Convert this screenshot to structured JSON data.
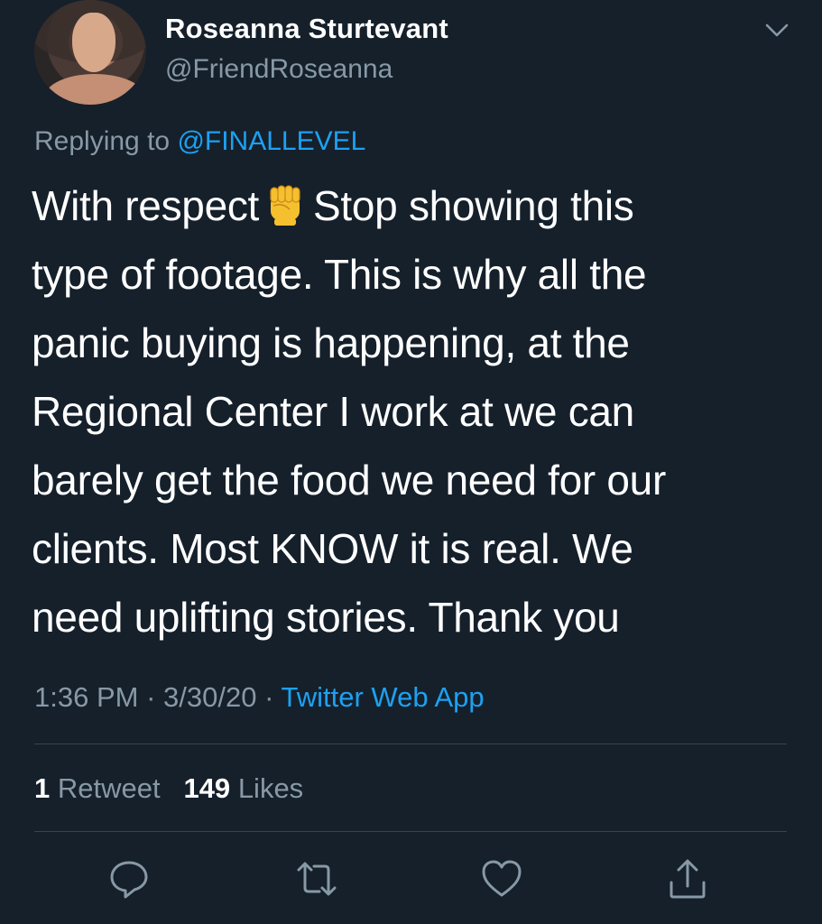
{
  "author": {
    "name": "Roseanna Sturtevant",
    "handle": "@FriendRoseanna",
    "avatar_icon": "profile-photo"
  },
  "reply": {
    "prefix": "Replying to",
    "mention": "@FINALLEVEL"
  },
  "tweet": {
    "text_before_emoji": "With respect",
    "emoji": "raised-fist-emoji",
    "text_after_emoji": "Stop showing this\ntype of footage. This is why all the\npanic buying is happening, at the\nRegional Center I work at we can\nbarely get the food we need for our\nclients. Most KNOW it is real. We\nneed uplifting stories. Thank you"
  },
  "meta": {
    "time": "1:36 PM",
    "sep1": "·",
    "date": "3/30/20",
    "sep2": "·",
    "source": "Twitter Web App"
  },
  "stats": {
    "retweet_count": "1",
    "retweet_label": "Retweet",
    "like_count": "149",
    "like_label": "Likes"
  },
  "actions": [
    {
      "name": "reply",
      "icon": "reply-icon"
    },
    {
      "name": "retweet",
      "icon": "retweet-icon"
    },
    {
      "name": "like",
      "icon": "heart-icon"
    },
    {
      "name": "share",
      "icon": "share-icon"
    }
  ],
  "colors": {
    "background": "#15202b",
    "text_primary": "#ffffff",
    "text_secondary": "#8899a6",
    "accent": "#1da1f2",
    "divider": "#38444d"
  }
}
